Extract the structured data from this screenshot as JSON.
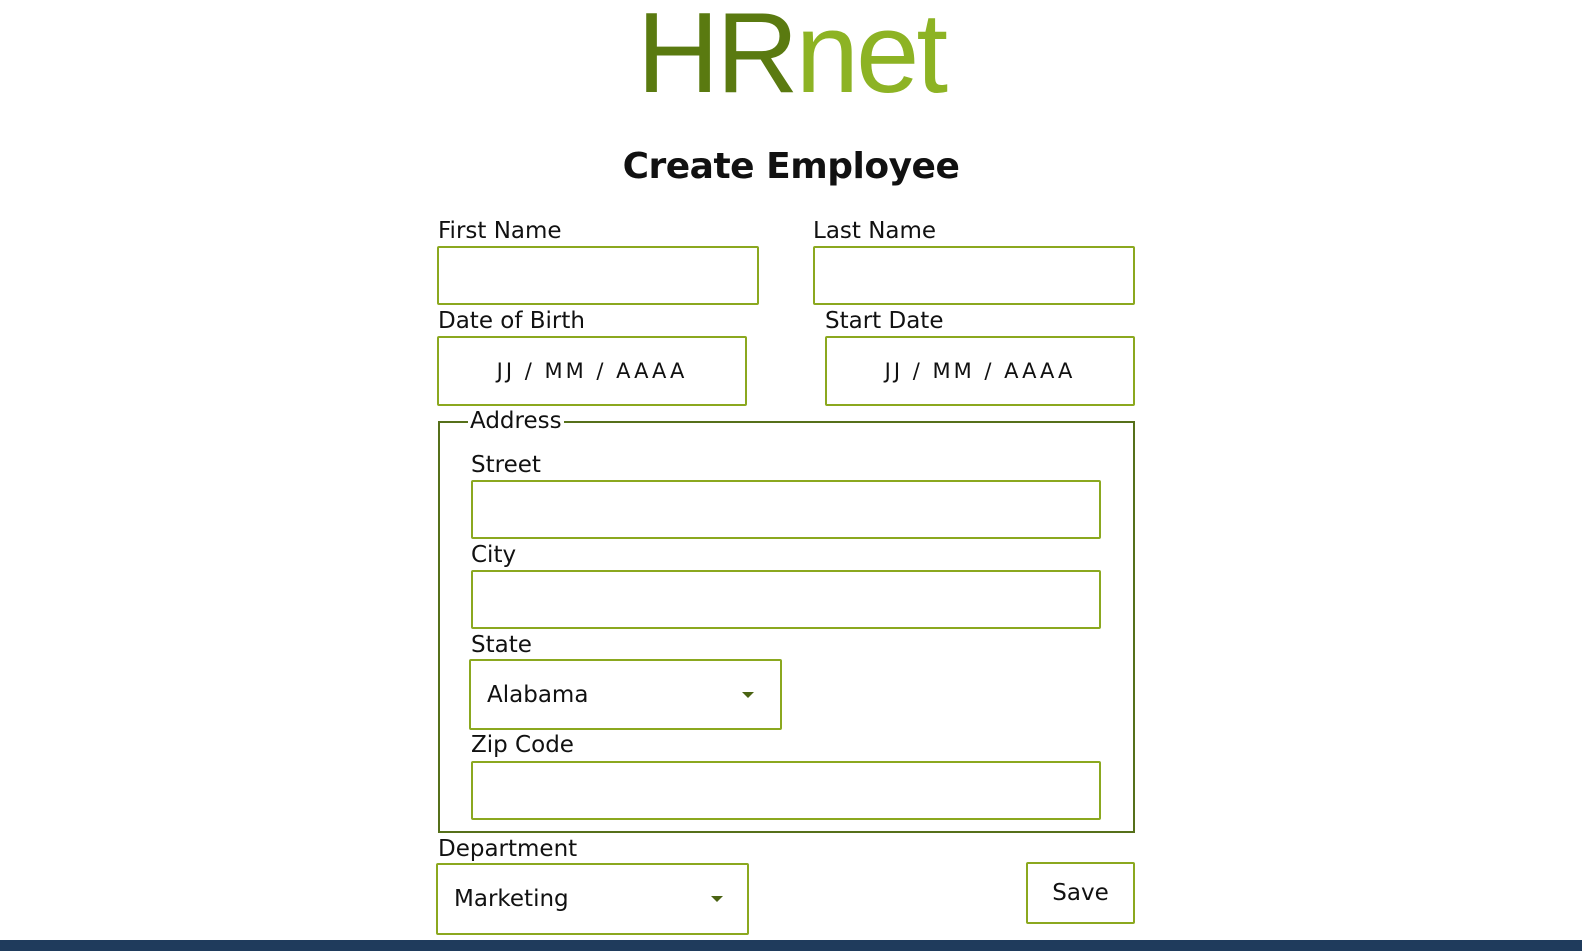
{
  "brand": {
    "logo_part1": "HR",
    "logo_part2": "net",
    "colors": {
      "logo_dark": "#5a7a10",
      "logo_light": "#8db324",
      "input_border": "#8ba81f",
      "fieldset_border": "#56701a"
    }
  },
  "page": {
    "title": "Create Employee"
  },
  "form": {
    "first_name": {
      "label": "First Name",
      "value": ""
    },
    "last_name": {
      "label": "Last Name",
      "value": ""
    },
    "date_of_birth": {
      "label": "Date of Birth",
      "placeholder": "JJ / MM / AAAA"
    },
    "start_date": {
      "label": "Start Date",
      "placeholder": "JJ / MM / AAAA"
    },
    "address": {
      "legend": "Address",
      "street": {
        "label": "Street",
        "value": ""
      },
      "city": {
        "label": "City",
        "value": ""
      },
      "state": {
        "label": "State",
        "selected": "Alabama"
      },
      "zip_code": {
        "label": "Zip Code",
        "value": ""
      }
    },
    "department": {
      "label": "Department",
      "selected": "Marketing"
    },
    "save_label": "Save"
  }
}
